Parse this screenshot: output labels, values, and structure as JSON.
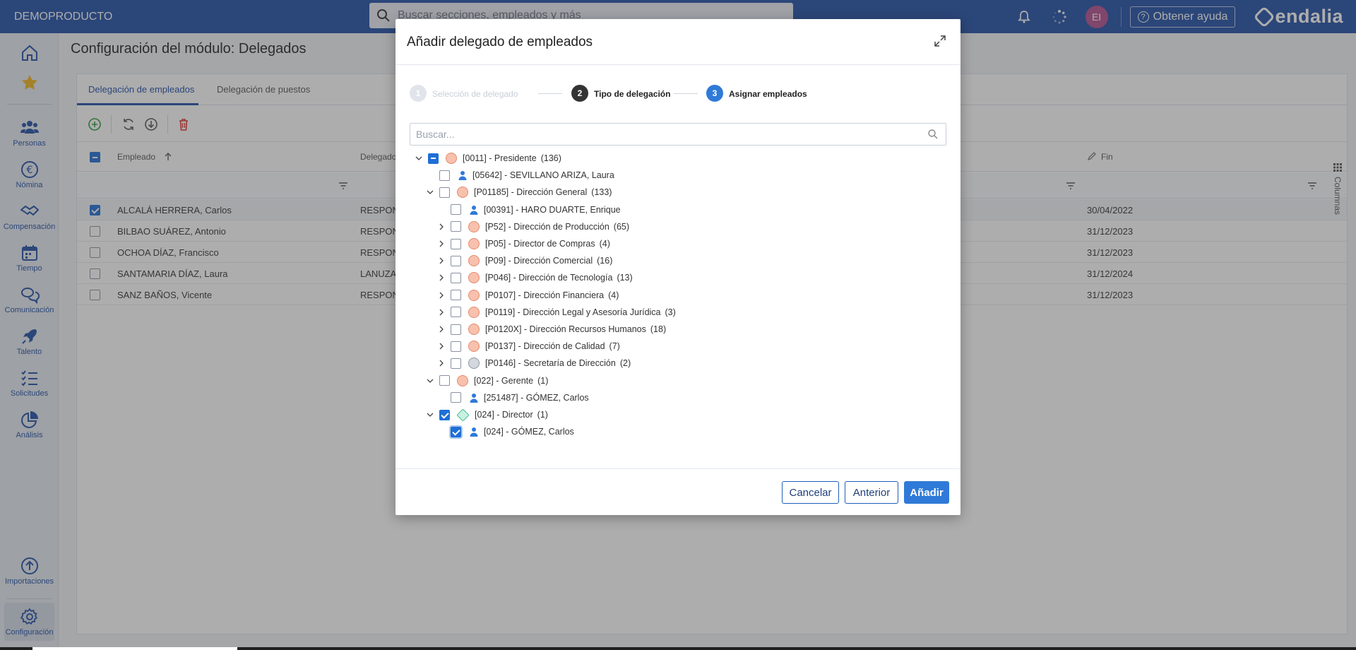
{
  "app": {
    "name": "DEMOPRODUCTO"
  },
  "search": {
    "placeholder": "Buscar secciones, empleados y más"
  },
  "header": {
    "avatar_initials": "EI",
    "help_label": "Obtener ayuda",
    "logo_text": "endalia"
  },
  "sidebar": {
    "items": [
      {
        "label": "",
        "icon": "home-icon"
      },
      {
        "label": "",
        "icon": "star-icon"
      },
      {
        "label": "Personas",
        "icon": "people-icon"
      },
      {
        "label": "Nómina",
        "icon": "euro-icon"
      },
      {
        "label": "Compensación",
        "icon": "handshake-icon"
      },
      {
        "label": "Tiempo",
        "icon": "calendar-icon"
      },
      {
        "label": "Comunicación",
        "icon": "chat-icon"
      },
      {
        "label": "Talento",
        "icon": "rocket-icon"
      },
      {
        "label": "Solicitudes",
        "icon": "checklist-icon"
      },
      {
        "label": "Análisis",
        "icon": "pie-chart-icon"
      },
      {
        "label": "Importaciones",
        "icon": "upload-icon"
      },
      {
        "label": "Configuración",
        "icon": "gear-icon"
      }
    ]
  },
  "page": {
    "title": "Configuración del módulo: Delegados",
    "tabs": [
      {
        "label": "Delegación de empleados"
      },
      {
        "label": "Delegación de puestos"
      }
    ],
    "columns": {
      "employee": "Empleado",
      "delegate": "Delegado",
      "end": "Fin"
    },
    "columns_panel": "Columnas",
    "rows": [
      {
        "employee": "ALCALÁ HERRERA, Carlos",
        "delegate": "RESPON",
        "end": "30/04/2022",
        "selected": true
      },
      {
        "employee": "BILBAO SUÁREZ, Antonio",
        "delegate": "RESPON",
        "end": "31/12/2023",
        "selected": false
      },
      {
        "employee": "OCHOA DÍAZ, Francisco",
        "delegate": "RESPON",
        "end": "31/12/2023",
        "selected": false
      },
      {
        "employee": "SANTAMARIA DÍAZ, Laura",
        "delegate": "LANUZA",
        "end": "31/12/2024",
        "selected": false
      },
      {
        "employee": "SANZ BAÑOS, Vicente",
        "delegate": "RESPON",
        "end": "31/12/2023",
        "selected": false
      }
    ]
  },
  "modal": {
    "title": "Añadir delegado de empleados",
    "steps": [
      {
        "num": "1",
        "label": "Selección de delegado",
        "state": "done"
      },
      {
        "num": "2",
        "label": "Tipo de delegación",
        "state": "visited"
      },
      {
        "num": "3",
        "label": "Asignar empleados",
        "state": "active"
      }
    ],
    "search_placeholder": "Buscar...",
    "tree": [
      {
        "text": "[0011] - Presidente",
        "count": "(136)",
        "kind": "position",
        "level": 0,
        "toggle": "open",
        "check": "indet"
      },
      {
        "text": "[05642] - SEVILLANO ARIZA, Laura",
        "count": "",
        "kind": "person",
        "level": 1,
        "toggle": "none",
        "check": "off"
      },
      {
        "text": "[P01185] - Dirección General",
        "count": "(133)",
        "kind": "position",
        "level": 1,
        "toggle": "open",
        "check": "off"
      },
      {
        "text": "[00391] - HARO DUARTE, Enrique",
        "count": "",
        "kind": "person",
        "level": 2,
        "toggle": "none",
        "check": "off"
      },
      {
        "text": "[P52] - Dirección de Producción",
        "count": "(65)",
        "kind": "position",
        "level": 2,
        "toggle": "closed",
        "check": "off"
      },
      {
        "text": "[P05] - Director de Compras",
        "count": "(4)",
        "kind": "position",
        "level": 2,
        "toggle": "closed",
        "check": "off"
      },
      {
        "text": "[P09] - Dirección Comercial",
        "count": "(16)",
        "kind": "position",
        "level": 2,
        "toggle": "closed",
        "check": "off"
      },
      {
        "text": "[P046] - Dirección de Tecnología",
        "count": "(13)",
        "kind": "position",
        "level": 2,
        "toggle": "closed",
        "check": "off"
      },
      {
        "text": "[P0107] - Dirección Financiera",
        "count": "(4)",
        "kind": "position",
        "level": 2,
        "toggle": "closed",
        "check": "off"
      },
      {
        "text": "[P0119] - Dirección Legal y Asesoría Jurídica",
        "count": "(3)",
        "kind": "position",
        "level": 2,
        "toggle": "closed",
        "check": "off"
      },
      {
        "text": "[P0120X] - Dirección Recursos Humanos",
        "count": "(18)",
        "kind": "position",
        "level": 2,
        "toggle": "closed",
        "check": "off"
      },
      {
        "text": "[P0137] - Dirección de Calidad",
        "count": "(7)",
        "kind": "position",
        "level": 2,
        "toggle": "closed",
        "check": "off"
      },
      {
        "text": "[P0146] - Secretaría de Dirección",
        "count": "(2)",
        "kind": "position-grey",
        "level": 2,
        "toggle": "closed",
        "check": "off"
      },
      {
        "text": "[022] - Gerente",
        "count": "(1)",
        "kind": "position",
        "level": 1,
        "toggle": "open",
        "check": "off"
      },
      {
        "text": "[251487] - GÓMEZ, Carlos",
        "count": "",
        "kind": "person",
        "level": 2,
        "toggle": "none",
        "check": "off"
      },
      {
        "text": "[024] - Director",
        "count": "(1)",
        "kind": "diamond",
        "level": 1,
        "toggle": "open",
        "check": "on"
      },
      {
        "text": "[024] - GÓMEZ, Carlos",
        "count": "",
        "kind": "person",
        "level": 2,
        "toggle": "none",
        "check": "on"
      }
    ],
    "buttons": {
      "cancel": "Cancelar",
      "back": "Anterior",
      "add": "Añadir"
    }
  },
  "colors": {
    "brand": "#1f4fa6",
    "primary": "#2f7ad8",
    "position": "#e6896a",
    "diamond": "#3fbf8f"
  }
}
